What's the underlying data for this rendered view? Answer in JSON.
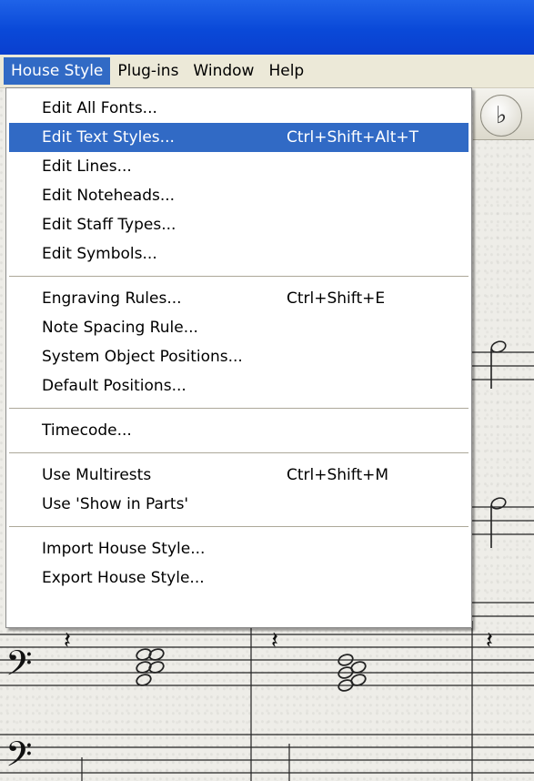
{
  "menubar": {
    "items": [
      {
        "label": "House Style",
        "active": true
      },
      {
        "label": "Plug-ins",
        "active": false
      },
      {
        "label": "Window",
        "active": false
      },
      {
        "label": "Help",
        "active": false
      }
    ]
  },
  "house_style_menu": {
    "groups": [
      [
        {
          "label": "Edit All Fonts...",
          "shortcut": ""
        },
        {
          "label": "Edit Text Styles...",
          "shortcut": "Ctrl+Shift+Alt+T",
          "highlighted": true
        },
        {
          "label": "Edit Lines...",
          "shortcut": ""
        },
        {
          "label": "Edit Noteheads...",
          "shortcut": ""
        },
        {
          "label": "Edit Staff Types...",
          "shortcut": ""
        },
        {
          "label": "Edit Symbols...",
          "shortcut": ""
        }
      ],
      [
        {
          "label": "Engraving Rules...",
          "shortcut": "Ctrl+Shift+E"
        },
        {
          "label": "Note Spacing Rule...",
          "shortcut": ""
        },
        {
          "label": "System Object Positions...",
          "shortcut": ""
        },
        {
          "label": "Default Positions...",
          "shortcut": ""
        }
      ],
      [
        {
          "label": "Timecode...",
          "shortcut": ""
        }
      ],
      [
        {
          "label": "Use Multirests",
          "shortcut": "Ctrl+Shift+M"
        },
        {
          "label": "Use 'Show in Parts'",
          "shortcut": ""
        }
      ],
      [
        {
          "label": "Import House Style...",
          "shortcut": ""
        },
        {
          "label": "Export House Style...",
          "shortcut": ""
        }
      ]
    ]
  },
  "toolbar": {
    "flat_button_icon": "flat-accidental-icon",
    "flat_glyph": "♭"
  },
  "colors": {
    "titlebar": "#0a49d8",
    "highlight": "#316ac5",
    "menubar": "#ece9d8",
    "paper": "#eeede8"
  },
  "score": {
    "glyphs": {
      "bass_clef": "𝄢",
      "quarter_rest": "𝄽"
    }
  }
}
